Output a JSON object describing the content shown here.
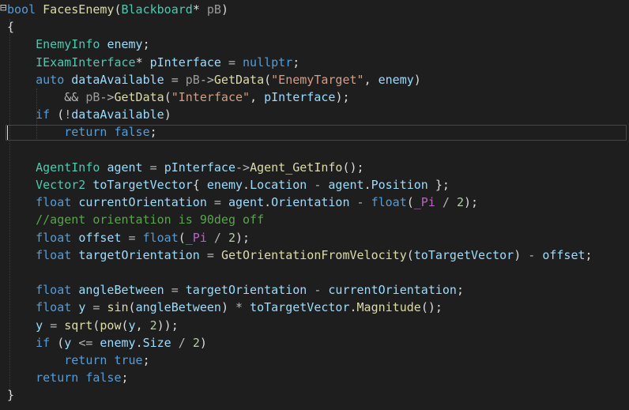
{
  "editor": {
    "colors": {
      "background": "#1e1e1e",
      "keyword": "#569cd6",
      "type": "#4ec9b0",
      "function": "#dcdcaa",
      "variable": "#9cdcfe",
      "parameter": "#9a9a9a",
      "string": "#d69d85",
      "comment": "#57a64a",
      "operator": "#b4b4b4",
      "number": "#b5cea8",
      "macro": "#bd63c5",
      "plain": "#dcdcdc"
    },
    "fold_icon": "collapse-minus-icon",
    "current_line": 8,
    "lines": [
      [
        [
          "kw",
          "bool"
        ],
        [
          "plain",
          " "
        ],
        [
          "fn",
          "FacesEnemy"
        ],
        [
          "plain",
          "("
        ],
        [
          "ty",
          "Blackboard"
        ],
        [
          "plain",
          "* "
        ],
        [
          "param",
          "pB"
        ],
        [
          "plain",
          ")"
        ]
      ],
      [
        [
          "plain",
          "{"
        ]
      ],
      [
        [
          "plain",
          "    "
        ],
        [
          "ty",
          "EnemyInfo"
        ],
        [
          "plain",
          " "
        ],
        [
          "var",
          "enemy"
        ],
        [
          "plain",
          ";"
        ]
      ],
      [
        [
          "plain",
          "    "
        ],
        [
          "ty",
          "IExamInterface"
        ],
        [
          "plain",
          "* "
        ],
        [
          "var",
          "pInterface"
        ],
        [
          "plain",
          " "
        ],
        [
          "op",
          "="
        ],
        [
          "plain",
          " "
        ],
        [
          "kw",
          "nullptr"
        ],
        [
          "plain",
          ";"
        ]
      ],
      [
        [
          "plain",
          "    "
        ],
        [
          "kw",
          "auto"
        ],
        [
          "plain",
          " "
        ],
        [
          "var",
          "dataAvailable"
        ],
        [
          "plain",
          " "
        ],
        [
          "op",
          "="
        ],
        [
          "plain",
          " "
        ],
        [
          "param",
          "pB"
        ],
        [
          "op",
          "->"
        ],
        [
          "fn",
          "GetData"
        ],
        [
          "plain",
          "("
        ],
        [
          "str",
          "\"EnemyTarget\""
        ],
        [
          "plain",
          ", "
        ],
        [
          "var",
          "enemy"
        ],
        [
          "plain",
          ")"
        ]
      ],
      [
        [
          "plain",
          "        "
        ],
        [
          "op",
          "&&"
        ],
        [
          "plain",
          " "
        ],
        [
          "param",
          "pB"
        ],
        [
          "op",
          "->"
        ],
        [
          "fn",
          "GetData"
        ],
        [
          "plain",
          "("
        ],
        [
          "str",
          "\"Interface\""
        ],
        [
          "plain",
          ", "
        ],
        [
          "var",
          "pInterface"
        ],
        [
          "plain",
          ");"
        ]
      ],
      [
        [
          "plain",
          "    "
        ],
        [
          "kw",
          "if"
        ],
        [
          "plain",
          " ("
        ],
        [
          "op",
          "!"
        ],
        [
          "var",
          "dataAvailable"
        ],
        [
          "plain",
          ")"
        ]
      ],
      [
        [
          "plain",
          "        "
        ],
        [
          "kw",
          "return"
        ],
        [
          "plain",
          " "
        ],
        [
          "kw",
          "false"
        ],
        [
          "plain",
          ";"
        ]
      ],
      [
        [
          "plain",
          ""
        ]
      ],
      [
        [
          "plain",
          "    "
        ],
        [
          "ty",
          "AgentInfo"
        ],
        [
          "plain",
          " "
        ],
        [
          "var",
          "agent"
        ],
        [
          "plain",
          " "
        ],
        [
          "op",
          "="
        ],
        [
          "plain",
          " "
        ],
        [
          "var",
          "pInterface"
        ],
        [
          "op",
          "->"
        ],
        [
          "fn",
          "Agent_GetInfo"
        ],
        [
          "plain",
          "();"
        ]
      ],
      [
        [
          "plain",
          "    "
        ],
        [
          "ty",
          "Vector2"
        ],
        [
          "plain",
          " "
        ],
        [
          "var",
          "toTargetVector"
        ],
        [
          "plain",
          "{ "
        ],
        [
          "var",
          "enemy"
        ],
        [
          "plain",
          "."
        ],
        [
          "var",
          "Location"
        ],
        [
          "plain",
          " "
        ],
        [
          "op",
          "-"
        ],
        [
          "plain",
          " "
        ],
        [
          "var",
          "agent"
        ],
        [
          "plain",
          "."
        ],
        [
          "var",
          "Position"
        ],
        [
          "plain",
          " };"
        ]
      ],
      [
        [
          "plain",
          "    "
        ],
        [
          "kw",
          "float"
        ],
        [
          "plain",
          " "
        ],
        [
          "var",
          "currentOrientation"
        ],
        [
          "plain",
          " "
        ],
        [
          "op",
          "="
        ],
        [
          "plain",
          " "
        ],
        [
          "var",
          "agent"
        ],
        [
          "plain",
          "."
        ],
        [
          "var",
          "Orientation"
        ],
        [
          "plain",
          " "
        ],
        [
          "op",
          "-"
        ],
        [
          "plain",
          " "
        ],
        [
          "kw",
          "float"
        ],
        [
          "plain",
          "("
        ],
        [
          "macro",
          "_Pi"
        ],
        [
          "plain",
          " "
        ],
        [
          "op",
          "/"
        ],
        [
          "plain",
          " "
        ],
        [
          "num",
          "2"
        ],
        [
          "plain",
          ");"
        ]
      ],
      [
        [
          "plain",
          "    "
        ],
        [
          "cmt",
          "//agent orientation is 90deg off"
        ]
      ],
      [
        [
          "plain",
          "    "
        ],
        [
          "kw",
          "float"
        ],
        [
          "plain",
          " "
        ],
        [
          "var",
          "offset"
        ],
        [
          "plain",
          " "
        ],
        [
          "op",
          "="
        ],
        [
          "plain",
          " "
        ],
        [
          "kw",
          "float"
        ],
        [
          "plain",
          "("
        ],
        [
          "macro",
          "_Pi"
        ],
        [
          "plain",
          " "
        ],
        [
          "op",
          "/"
        ],
        [
          "plain",
          " "
        ],
        [
          "num",
          "2"
        ],
        [
          "plain",
          ");"
        ]
      ],
      [
        [
          "plain",
          "    "
        ],
        [
          "kw",
          "float"
        ],
        [
          "plain",
          " "
        ],
        [
          "var",
          "targetOrientation"
        ],
        [
          "plain",
          " "
        ],
        [
          "op",
          "="
        ],
        [
          "plain",
          " "
        ],
        [
          "fn",
          "GetOrientationFromVelocity"
        ],
        [
          "plain",
          "("
        ],
        [
          "var",
          "toTargetVector"
        ],
        [
          "plain",
          ") "
        ],
        [
          "op",
          "-"
        ],
        [
          "plain",
          " "
        ],
        [
          "var",
          "offset"
        ],
        [
          "plain",
          ";"
        ]
      ],
      [
        [
          "plain",
          ""
        ]
      ],
      [
        [
          "plain",
          "    "
        ],
        [
          "kw",
          "float"
        ],
        [
          "plain",
          " "
        ],
        [
          "var",
          "angleBetween"
        ],
        [
          "plain",
          " "
        ],
        [
          "op",
          "="
        ],
        [
          "plain",
          " "
        ],
        [
          "var",
          "targetOrientation"
        ],
        [
          "plain",
          " "
        ],
        [
          "op",
          "-"
        ],
        [
          "plain",
          " "
        ],
        [
          "var",
          "currentOrientation"
        ],
        [
          "plain",
          ";"
        ]
      ],
      [
        [
          "plain",
          "    "
        ],
        [
          "kw",
          "float"
        ],
        [
          "plain",
          " "
        ],
        [
          "var",
          "y"
        ],
        [
          "plain",
          " "
        ],
        [
          "op",
          "="
        ],
        [
          "plain",
          " "
        ],
        [
          "fn",
          "sin"
        ],
        [
          "plain",
          "("
        ],
        [
          "var",
          "angleBetween"
        ],
        [
          "plain",
          ") "
        ],
        [
          "op",
          "*"
        ],
        [
          "plain",
          " "
        ],
        [
          "var",
          "toTargetVector"
        ],
        [
          "plain",
          "."
        ],
        [
          "fn",
          "Magnitude"
        ],
        [
          "plain",
          "();"
        ]
      ],
      [
        [
          "plain",
          "    "
        ],
        [
          "var",
          "y"
        ],
        [
          "plain",
          " "
        ],
        [
          "op",
          "="
        ],
        [
          "plain",
          " "
        ],
        [
          "fn",
          "sqrt"
        ],
        [
          "plain",
          "("
        ],
        [
          "fn",
          "pow"
        ],
        [
          "plain",
          "("
        ],
        [
          "var",
          "y"
        ],
        [
          "plain",
          ", "
        ],
        [
          "num",
          "2"
        ],
        [
          "plain",
          "));"
        ]
      ],
      [
        [
          "plain",
          "    "
        ],
        [
          "kw",
          "if"
        ],
        [
          "plain",
          " ("
        ],
        [
          "var",
          "y"
        ],
        [
          "plain",
          " "
        ],
        [
          "op",
          "<="
        ],
        [
          "plain",
          " "
        ],
        [
          "var",
          "enemy"
        ],
        [
          "plain",
          "."
        ],
        [
          "var",
          "Size"
        ],
        [
          "plain",
          " "
        ],
        [
          "op",
          "/"
        ],
        [
          "plain",
          " "
        ],
        [
          "num",
          "2"
        ],
        [
          "plain",
          ")"
        ]
      ],
      [
        [
          "plain",
          "        "
        ],
        [
          "kw",
          "return"
        ],
        [
          "plain",
          " "
        ],
        [
          "kw",
          "true"
        ],
        [
          "plain",
          ";"
        ]
      ],
      [
        [
          "plain",
          "    "
        ],
        [
          "kw",
          "return"
        ],
        [
          "plain",
          " "
        ],
        [
          "kw",
          "false"
        ],
        [
          "plain",
          ";"
        ]
      ],
      [
        [
          "plain",
          "}"
        ]
      ]
    ]
  }
}
